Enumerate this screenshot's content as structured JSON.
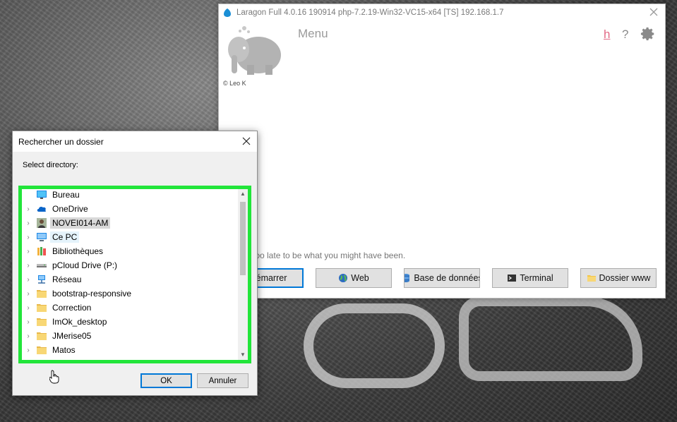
{
  "laragon": {
    "title": "Laragon Full 4.0.16 190914 php-7.2.19-Win32-VC15-x64 [TS]  192.168.1.7",
    "menu_label": "Menu",
    "help_h": "h",
    "help_q": "?",
    "copyright": "© Leo K",
    "quote": "er too late to be what you might have been.",
    "buttons": {
      "start": "Démarrer",
      "web": "Web",
      "database": "Base de données",
      "terminal": "Terminal",
      "www_folder": "Dossier www"
    }
  },
  "dialog": {
    "title": "Rechercher un dossier",
    "label": "Select directory:",
    "tree": [
      {
        "label": "Bureau",
        "icon": "desktop-icon",
        "chevron": ""
      },
      {
        "label": "OneDrive",
        "icon": "cloud-icon",
        "chevron": "›"
      },
      {
        "label": "NOVEI014-AM",
        "icon": "user-icon",
        "chevron": "›"
      },
      {
        "label": "Ce PC",
        "icon": "computer-icon",
        "chevron": "›"
      },
      {
        "label": "Bibliothèques",
        "icon": "library-icon",
        "chevron": "›"
      },
      {
        "label": "pCloud Drive (P:)",
        "icon": "drive-icon",
        "chevron": "›"
      },
      {
        "label": "Réseau",
        "icon": "network-icon",
        "chevron": "›"
      },
      {
        "label": "bootstrap-responsive",
        "icon": "folder-icon",
        "chevron": "›"
      },
      {
        "label": "Correction",
        "icon": "folder-icon",
        "chevron": "›"
      },
      {
        "label": "ImOk_desktop",
        "icon": "folder-icon",
        "chevron": "›"
      },
      {
        "label": "JMerise05",
        "icon": "folder-icon",
        "chevron": "›"
      },
      {
        "label": "Matos",
        "icon": "folder-icon",
        "chevron": "›"
      }
    ],
    "ok_label": "OK",
    "cancel_label": "Annuler"
  },
  "colors": {
    "highlight_frame": "#22e53a",
    "accent": "#0078d7",
    "help_pink": "#e26a86"
  }
}
